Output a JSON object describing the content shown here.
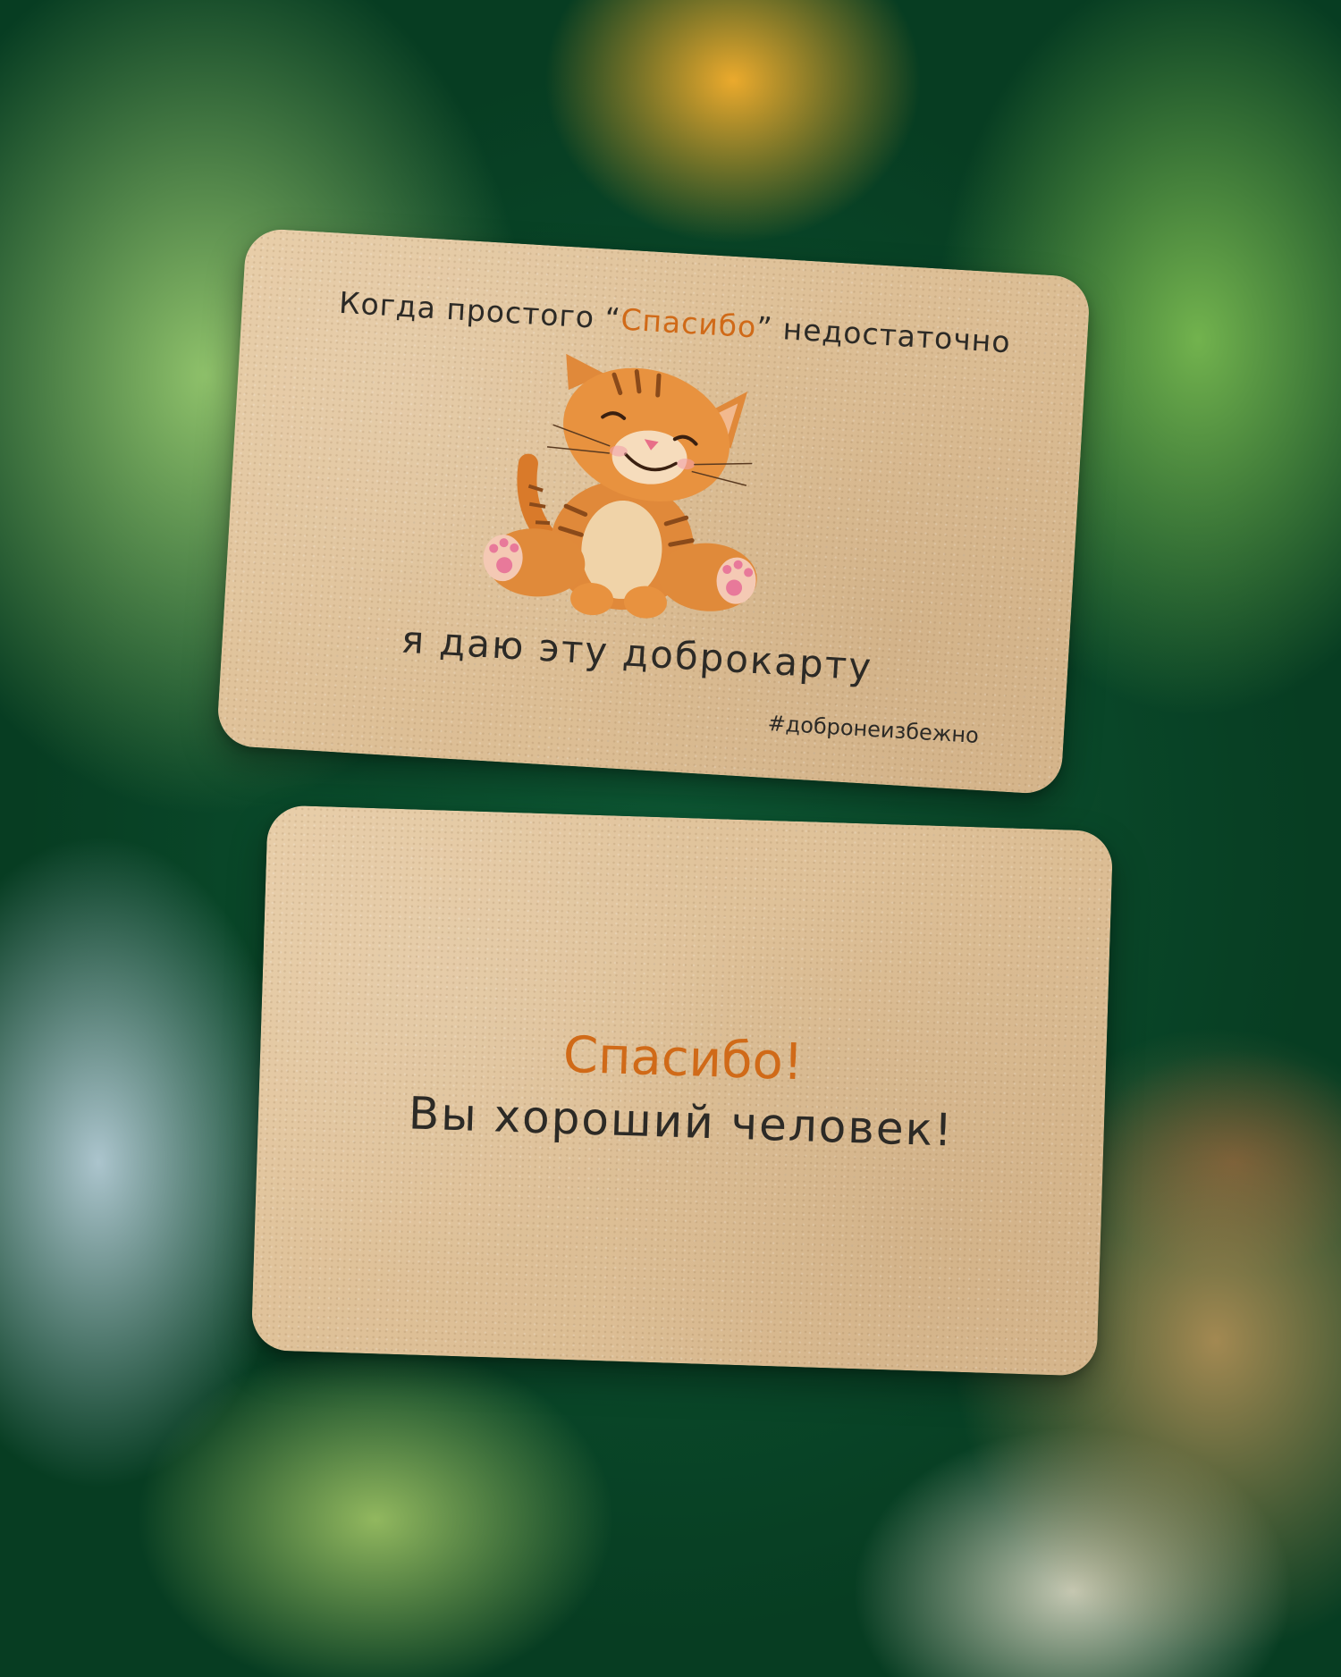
{
  "front_card": {
    "line1_before": "Когда простого ",
    "line1_quote_open": "“",
    "line1_highlight": "Спасибо",
    "line1_quote_close": "”",
    "line1_after": " недостаточно",
    "line2": "я даю эту доброкарту",
    "hashtag": "#добронеизбежно",
    "illustration": "smiling orange tabby kitten"
  },
  "back_card": {
    "thanks": "Спасибо!",
    "message": "Вы хороший человек!"
  },
  "colors": {
    "card": "#dfc39b",
    "accent_orange": "#d06a18",
    "text": "#2c2a26",
    "background_green": "#0a4a2a"
  }
}
